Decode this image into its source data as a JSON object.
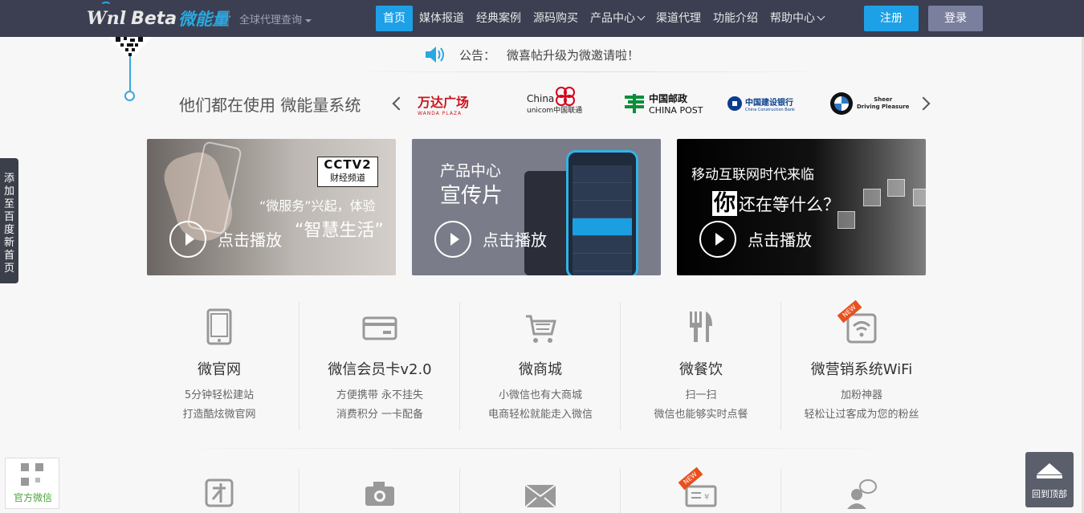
{
  "header": {
    "logo_latin": "Wnl",
    "logo_beta": "Beta",
    "logo_cn": "微能量",
    "agent_query": "全球代理查询",
    "nav": [
      {
        "label": "首页",
        "active": true,
        "dropdown": false
      },
      {
        "label": "媒体报道",
        "dropdown": false
      },
      {
        "label": "经典案例",
        "dropdown": false
      },
      {
        "label": "源码购买",
        "dropdown": false
      },
      {
        "label": "产品中心",
        "dropdown": true
      },
      {
        "label": "渠道代理",
        "dropdown": false
      },
      {
        "label": "功能介绍",
        "dropdown": false
      },
      {
        "label": "帮助中心",
        "dropdown": true
      }
    ],
    "register": "注册",
    "login": "登录"
  },
  "announcement": {
    "label": "公告：",
    "text": "微喜帖升级为微邀请啦！"
  },
  "partners": {
    "title": "他们都在使用 微能量系统",
    "logos": [
      {
        "name": "wanda",
        "cn": "万达广场",
        "en": "WANDA PLAZA"
      },
      {
        "name": "unicom",
        "en1": "China",
        "en2": "unicom中国联通"
      },
      {
        "name": "china-post",
        "cn": "中国邮政",
        "en": "CHINA POST"
      },
      {
        "name": "ccb",
        "cn": "中国建设银行",
        "en": "China Construction Bank"
      },
      {
        "name": "bmw",
        "line1": "Sheer",
        "line2": "Driving Pleasure"
      }
    ]
  },
  "banners": [
    {
      "logo_top": "CCTV2",
      "logo_bottom": "财经频道",
      "line1": "“微服务”兴起，体验",
      "line2": "“智慧生活”",
      "play": "点击播放"
    },
    {
      "line1": "产品中心",
      "line2": "宣传片",
      "play": "点击播放"
    },
    {
      "line1": "移动互联网时代来临",
      "big": "你",
      "line2": "还在等什么？",
      "play": "点击播放"
    }
  ],
  "features": [
    {
      "title": "微官网",
      "l1": "5分钟轻松建站",
      "l2": "打造酷炫微官网",
      "icon": "tablet-icon"
    },
    {
      "title": "微信会员卡v2.0",
      "l1": "方便携带 永不挂失",
      "l2": "消费积分 一卡配备",
      "icon": "card-icon"
    },
    {
      "title": "微商城",
      "l1": "小微信也有大商城",
      "l2": "电商轻松就能走入微信",
      "icon": "cart-icon"
    },
    {
      "title": "微餐饮",
      "l1": "扫一扫",
      "l2": "微信也能够实时点餐",
      "icon": "fork-knife-icon"
    },
    {
      "title": "微营销系统WiFi",
      "l1": "加粉神器",
      "l2": "轻松让过客成为您的粉丝",
      "icon": "wifi-icon",
      "new": "NEW"
    }
  ],
  "features_row2_icons": [
    "talent-icon",
    "camera-icon",
    "envelope-icon",
    "ticket-icon",
    "chat-user-icon"
  ],
  "features_row2_new": "NEW",
  "side": {
    "add_to_baidu": [
      "添",
      "加",
      "至",
      "百",
      "度",
      "新",
      "首",
      "页"
    ],
    "wechat_label": "官方微信",
    "back_to_top": "回到顶部"
  },
  "colors": {
    "nav_bg": "#3b3f51",
    "accent": "#1ea0e6",
    "login_bg": "#7b7f9e"
  }
}
